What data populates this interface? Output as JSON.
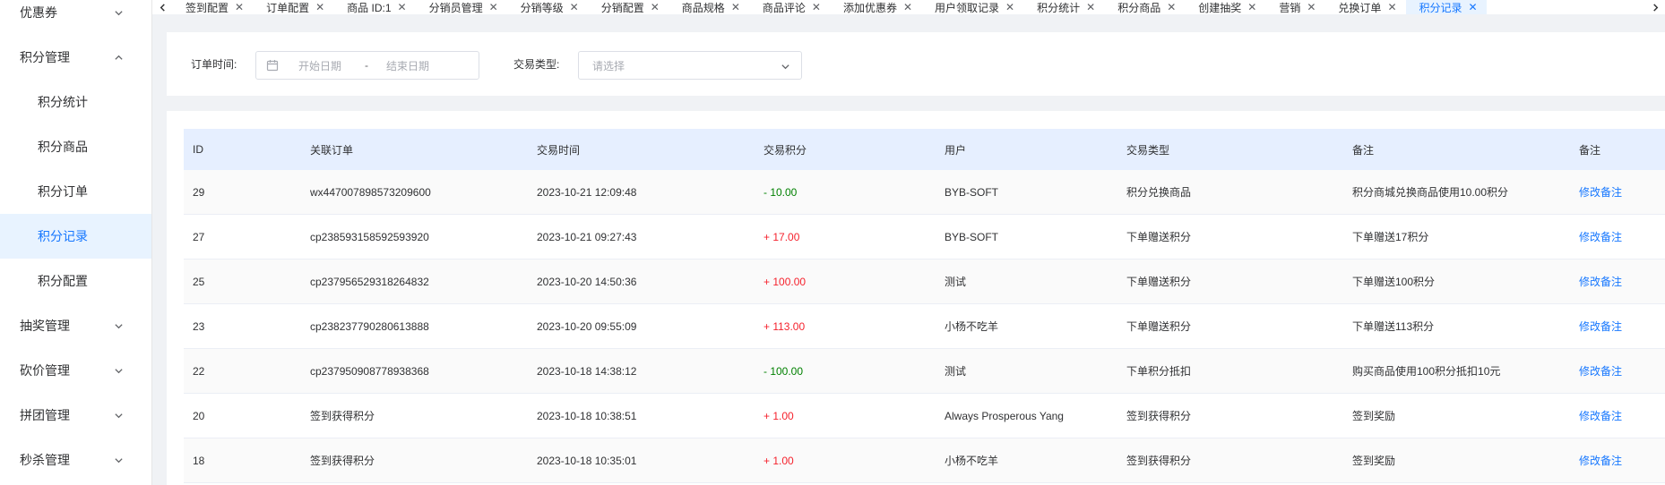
{
  "sidebar": {
    "items": [
      {
        "label": "优惠券",
        "type": "group",
        "expanded": false
      },
      {
        "label": "积分管理",
        "type": "group",
        "expanded": true
      },
      {
        "label": "积分统计",
        "type": "sub"
      },
      {
        "label": "积分商品",
        "type": "sub"
      },
      {
        "label": "积分订单",
        "type": "sub"
      },
      {
        "label": "积分记录",
        "type": "sub",
        "active": true
      },
      {
        "label": "积分配置",
        "type": "sub"
      },
      {
        "label": "抽奖管理",
        "type": "group",
        "expanded": false
      },
      {
        "label": "砍价管理",
        "type": "group",
        "expanded": false
      },
      {
        "label": "拼团管理",
        "type": "group",
        "expanded": false
      },
      {
        "label": "秒杀管理",
        "type": "group",
        "expanded": false
      }
    ]
  },
  "tabs": [
    {
      "label": "签到配置"
    },
    {
      "label": "订单配置"
    },
    {
      "label": "商品 ID:1"
    },
    {
      "label": "分销员管理"
    },
    {
      "label": "分销等级"
    },
    {
      "label": "分销配置"
    },
    {
      "label": "商品规格"
    },
    {
      "label": "商品评论"
    },
    {
      "label": "添加优惠券"
    },
    {
      "label": "用户领取记录"
    },
    {
      "label": "积分统计"
    },
    {
      "label": "积分商品"
    },
    {
      "label": "创建抽奖"
    },
    {
      "label": "营销"
    },
    {
      "label": "兑换订单"
    },
    {
      "label": "积分记录",
      "active": true
    }
  ],
  "filters": {
    "order_time_label": "订单时间:",
    "start_placeholder": "开始日期",
    "range_separator": "-",
    "end_placeholder": "结束日期",
    "trade_type_label": "交易类型:",
    "trade_type_placeholder": "请选择"
  },
  "table": {
    "headers": [
      "ID",
      "关联订单",
      "交易时间",
      "交易积分",
      "用户",
      "交易类型",
      "备注",
      "备注"
    ],
    "rows": [
      {
        "id": "29",
        "order": "wx447007898573209600",
        "time": "2023-10-21 12:09:48",
        "points": "- 10.00",
        "sign": "neg",
        "user": "BYB-SOFT",
        "type": "积分兑换商品",
        "remark": "积分商城兑换商品使用10.00积分",
        "action": "修改备注"
      },
      {
        "id": "27",
        "order": "cp238593158592593920",
        "time": "2023-10-21 09:27:43",
        "points": "+ 17.00",
        "sign": "pos",
        "user": "BYB-SOFT",
        "type": "下单赠送积分",
        "remark": "下单赠送17积分",
        "action": "修改备注"
      },
      {
        "id": "25",
        "order": "cp237956529318264832",
        "time": "2023-10-20 14:50:36",
        "points": "+ 100.00",
        "sign": "pos",
        "user": "测试",
        "type": "下单赠送积分",
        "remark": "下单赠送100积分",
        "action": "修改备注"
      },
      {
        "id": "23",
        "order": "cp238237790280613888",
        "time": "2023-10-20 09:55:09",
        "points": "+ 113.00",
        "sign": "pos",
        "user": "小杨不吃羊",
        "type": "下单赠送积分",
        "remark": "下单赠送113积分",
        "action": "修改备注"
      },
      {
        "id": "22",
        "order": "cp237950908778938368",
        "time": "2023-10-18 14:38:12",
        "points": "- 100.00",
        "sign": "neg",
        "user": "测试",
        "type": "下单积分抵扣",
        "remark": "购买商品使用100积分抵扣10元",
        "action": "修改备注"
      },
      {
        "id": "20",
        "order": "签到获得积分",
        "time": "2023-10-18 10:38:51",
        "points": "+ 1.00",
        "sign": "pos",
        "user": "Always Prosperous Yang",
        "type": "签到获得积分",
        "remark": "签到奖励",
        "action": "修改备注"
      },
      {
        "id": "18",
        "order": "签到获得积分",
        "time": "2023-10-18 10:35:01",
        "points": "+ 1.00",
        "sign": "pos",
        "user": "小杨不吃羊",
        "type": "签到获得积分",
        "remark": "签到奖励",
        "action": "修改备注"
      }
    ]
  }
}
